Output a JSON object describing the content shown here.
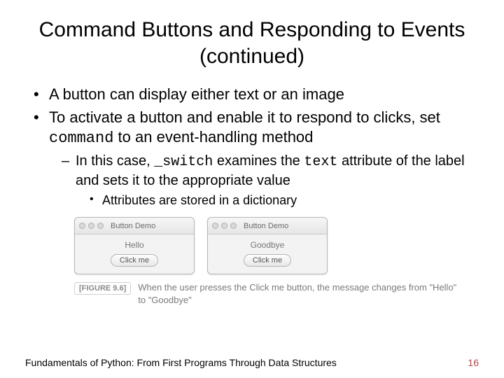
{
  "title": "Command Buttons and Responding to Events (continued)",
  "bullets": {
    "b1": "A button can display either text or an image",
    "b2_pre": "To activate a button and enable it to respond to clicks, set ",
    "b2_code": "command",
    "b2_post": " to an event-handling method",
    "b2a_pre": "In this case, ",
    "b2a_code1": "_switch",
    "b2a_mid": " examines the ",
    "b2a_code2": "text",
    "b2a_post": " attribute of the label and sets it to the appropriate value",
    "b2a_i": "Attributes are stored in a dictionary"
  },
  "figure": {
    "win_title": "Button Demo",
    "label_left": "Hello",
    "label_right": "Goodbye",
    "button_label": "Click me",
    "badge": "[FIGURE 9.6]",
    "caption": "When the user presses the Click me button, the message changes from \"Hello\" to \"Goodbye\""
  },
  "footer": {
    "text": "Fundamentals of Python: From First Programs Through Data Structures",
    "page": "16"
  }
}
